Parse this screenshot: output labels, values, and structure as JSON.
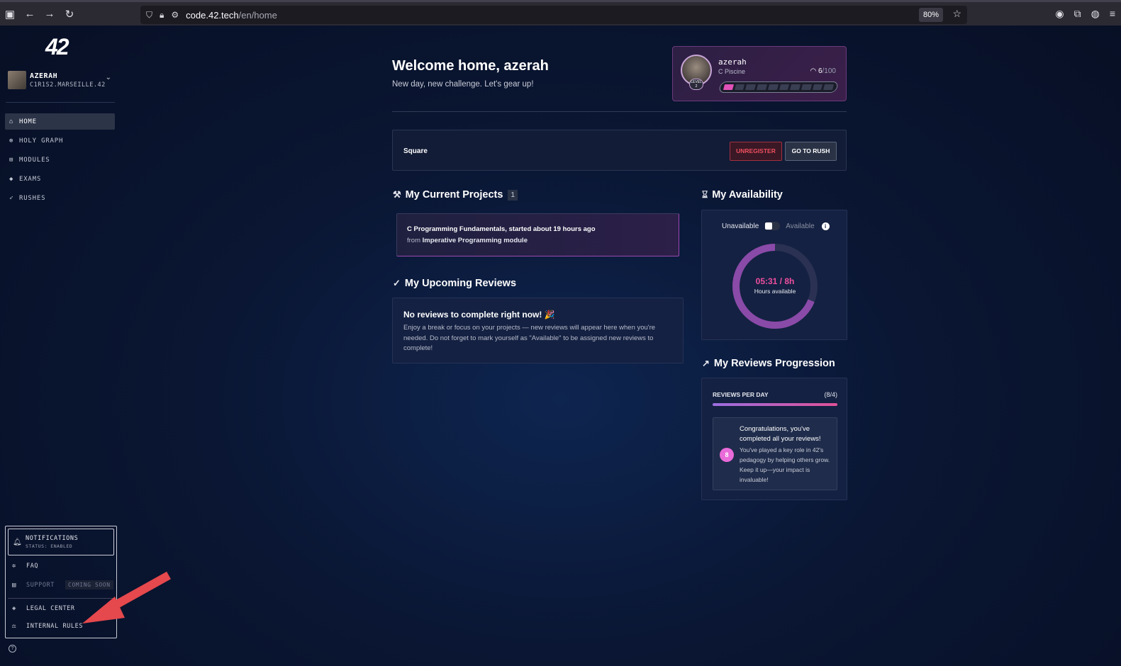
{
  "browser": {
    "url_host": "code.42.tech",
    "url_path": "/en/home",
    "zoom": "80%"
  },
  "sidebar": {
    "logo": "42",
    "user": {
      "name": "AZERAH",
      "login": "C1R1S2.MARSEILLE.42"
    },
    "nav": [
      {
        "label": "HOME",
        "icon": "home-icon",
        "active": true
      },
      {
        "label": "HOLY GRAPH",
        "icon": "graph-icon"
      },
      {
        "label": "MODULES",
        "icon": "grid-icon"
      },
      {
        "label": "EXAMS",
        "icon": "graduation-cap-icon"
      },
      {
        "label": "RUSHES",
        "icon": "rocket-icon"
      }
    ],
    "bottom": {
      "notifications": {
        "label": "NOTIFICATIONS",
        "status": "STATUS: ENABLED"
      },
      "faq": "FAQ",
      "support": "SUPPORT",
      "coming_soon": "COMING SOON",
      "legal": "LEGAL CENTER",
      "rules": "INTERNAL RULES"
    }
  },
  "header": {
    "title": "Welcome home, azerah",
    "subtitle": "New day, new challenge. Let's gear up!"
  },
  "profile": {
    "name": "azerah",
    "course": "C Piscine",
    "score": "6",
    "score_max": "/100",
    "level_label": "LEVEL",
    "level": "2",
    "progress_fraction": 0.06
  },
  "rush": {
    "name": "Square",
    "unregister": "UNREGISTER",
    "go": "GO TO RUSH"
  },
  "projects": {
    "title": "My Current Projects",
    "count": "1",
    "item": {
      "title": "C Programming Fundamentals, started about 19 hours ago",
      "from_prefix": "from",
      "module": "Imperative Programming module"
    }
  },
  "reviews": {
    "title": "My Upcoming Reviews",
    "empty_title": "No reviews to complete right now! 🎉",
    "empty_text": "Enjoy a break or focus on your projects — new reviews will appear here when you're needed. Do not forget to mark yourself as \"Available\" to be assigned new reviews to complete!"
  },
  "availability": {
    "title": "My Availability",
    "unavailable": "Unavailable",
    "available": "Available",
    "time": "05:31 / 8h",
    "label": "Hours available",
    "fraction": 0.69
  },
  "progression": {
    "title": "My Reviews Progression",
    "header": "REVIEWS PER DAY",
    "count": "(8/4)",
    "badge": "8",
    "congrats_title": "Congratulations, you've completed all your reviews!",
    "congrats_text": "You've played a key role in 42's pedagogy by helping others grow. Keep it up—your impact is invaluable!"
  },
  "colors": {
    "accent_pink": "#ef4f9f",
    "danger": "#ef4f5f",
    "background": "#0a1633"
  }
}
